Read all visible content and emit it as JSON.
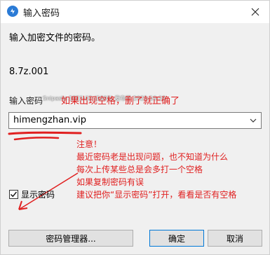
{
  "window": {
    "title": "输入密码",
    "app_icon": "bandizip-icon",
    "close_icon": "close-icon"
  },
  "prompt": "输入加密文件的密码。",
  "file_name": "8.7z.001",
  "password": {
    "label": "输入密码",
    "watermark": "Snipaste 2022-02 (2608) 发布于 2022-10-19",
    "value": "himengzhan.vip",
    "dropdown_icon": "chevron-down-icon"
  },
  "annotations": {
    "top_note": "如果出现空格，删了就正确了",
    "note_lines": [
      "注意！",
      "最近密码老是出现问题，也不知道为什么",
      "每次上传某些总是会多打一个空格",
      "如果复制密码有误",
      "建议把你“显示密码”打开，看看是否有空格"
    ],
    "color": "#e02020"
  },
  "show_password": {
    "label": "显示密码",
    "checked": true
  },
  "buttons": {
    "manager": "密码管理器...",
    "ok": "确定",
    "cancel": "取消"
  }
}
